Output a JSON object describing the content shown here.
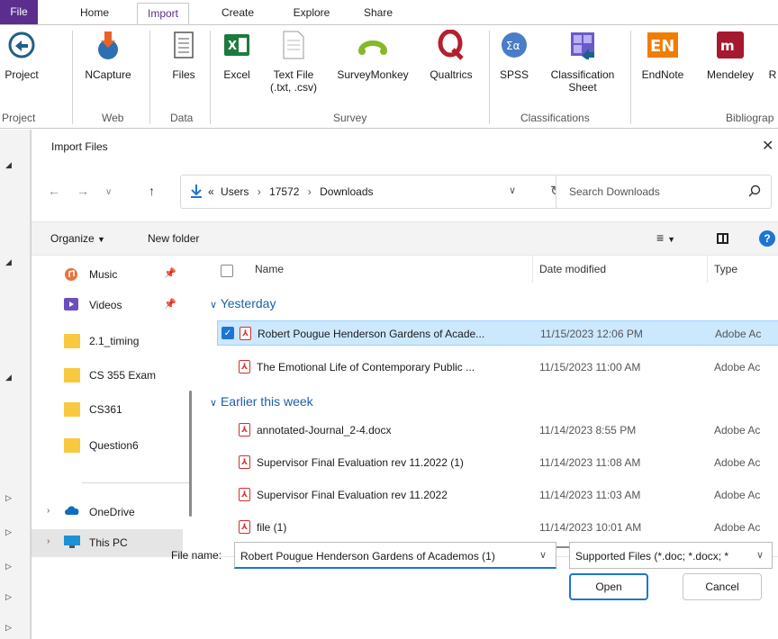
{
  "ribbon": {
    "tabs": [
      "File",
      "Home",
      "Import",
      "Create",
      "Explore",
      "Share"
    ],
    "active_tab": "Import",
    "buttons": {
      "project": "Project",
      "ncapture": "NCapture",
      "files": "Files",
      "excel": "Excel",
      "textfile_line1": "Text File",
      "textfile_line2": "(.txt, .csv)",
      "surveymonkey": "SurveyMonkey",
      "qualtrics": "Qualtrics",
      "spss": "SPSS",
      "classification_line1": "Classification",
      "classification_line2": "Sheet",
      "endnote": "EndNote",
      "mendeley": "Mendeley"
    },
    "groups": {
      "project": "Project",
      "web": "Web",
      "data": "Data",
      "survey": "Survey",
      "classifications": "Classifications",
      "bibliography": "Bibliograp"
    },
    "colors": {
      "brand": "#5b2d8f",
      "excel": "#1d7a3e",
      "endnote": "#f07d00",
      "mendeley": "#a6192e",
      "qualtrics": "#b51f2e"
    }
  },
  "dialog": {
    "title": "Import Files",
    "address": {
      "overflow": "«",
      "crumbs": [
        "Users",
        "17572",
        "Downloads"
      ]
    },
    "search_placeholder": "Search Downloads",
    "toolbar": {
      "organize": "Organize",
      "new_folder": "New folder"
    },
    "nav": [
      {
        "label": "Music",
        "icon": "music-icon"
      },
      {
        "label": "Videos",
        "icon": "videos-icon"
      },
      {
        "label": "2.1_timing",
        "icon": "folder-icon"
      },
      {
        "label": "CS 355 Exam",
        "icon": "folder-icon"
      },
      {
        "label": "CS361",
        "icon": "folder-icon"
      },
      {
        "label": "Question6",
        "icon": "folder-icon"
      },
      {
        "label": "OneDrive",
        "icon": "cloud-icon"
      },
      {
        "label": "This PC",
        "icon": "computer-icon"
      }
    ],
    "columns": {
      "name": "Name",
      "date": "Date modified",
      "type": "Type"
    },
    "groups": [
      {
        "label": "Yesterday",
        "files": [
          {
            "name": "Robert Pougue Henderson Gardens of Acade...",
            "date": "11/15/2023 12:06 PM",
            "type": "Adobe Ac",
            "selected": true
          },
          {
            "name": "The Emotional Life of Contemporary Public ...",
            "date": "11/15/2023 11:00 AM",
            "type": "Adobe Ac",
            "selected": false
          }
        ]
      },
      {
        "label": "Earlier this week",
        "files": [
          {
            "name": "annotated-Journal_2-4.docx",
            "date": "11/14/2023 8:55 PM",
            "type": "Adobe Ac",
            "selected": false
          },
          {
            "name": "Supervisor Final Evaluation rev 11.2022 (1)",
            "date": "11/14/2023 11:08 AM",
            "type": "Adobe Ac",
            "selected": false
          },
          {
            "name": "Supervisor Final Evaluation rev 11.2022",
            "date": "11/14/2023 11:03 AM",
            "type": "Adobe Ac",
            "selected": false
          },
          {
            "name": "file (1)",
            "date": "11/14/2023 10:01 AM",
            "type": "Adobe Ac",
            "selected": false
          }
        ]
      }
    ],
    "file_name_label": "File name:",
    "file_name_value": "Robert Pougue Henderson Gardens of Academos (1)",
    "file_type_value": "Supported Files (*.doc; *.docx; *",
    "open_label": "Open",
    "cancel_label": "Cancel"
  }
}
